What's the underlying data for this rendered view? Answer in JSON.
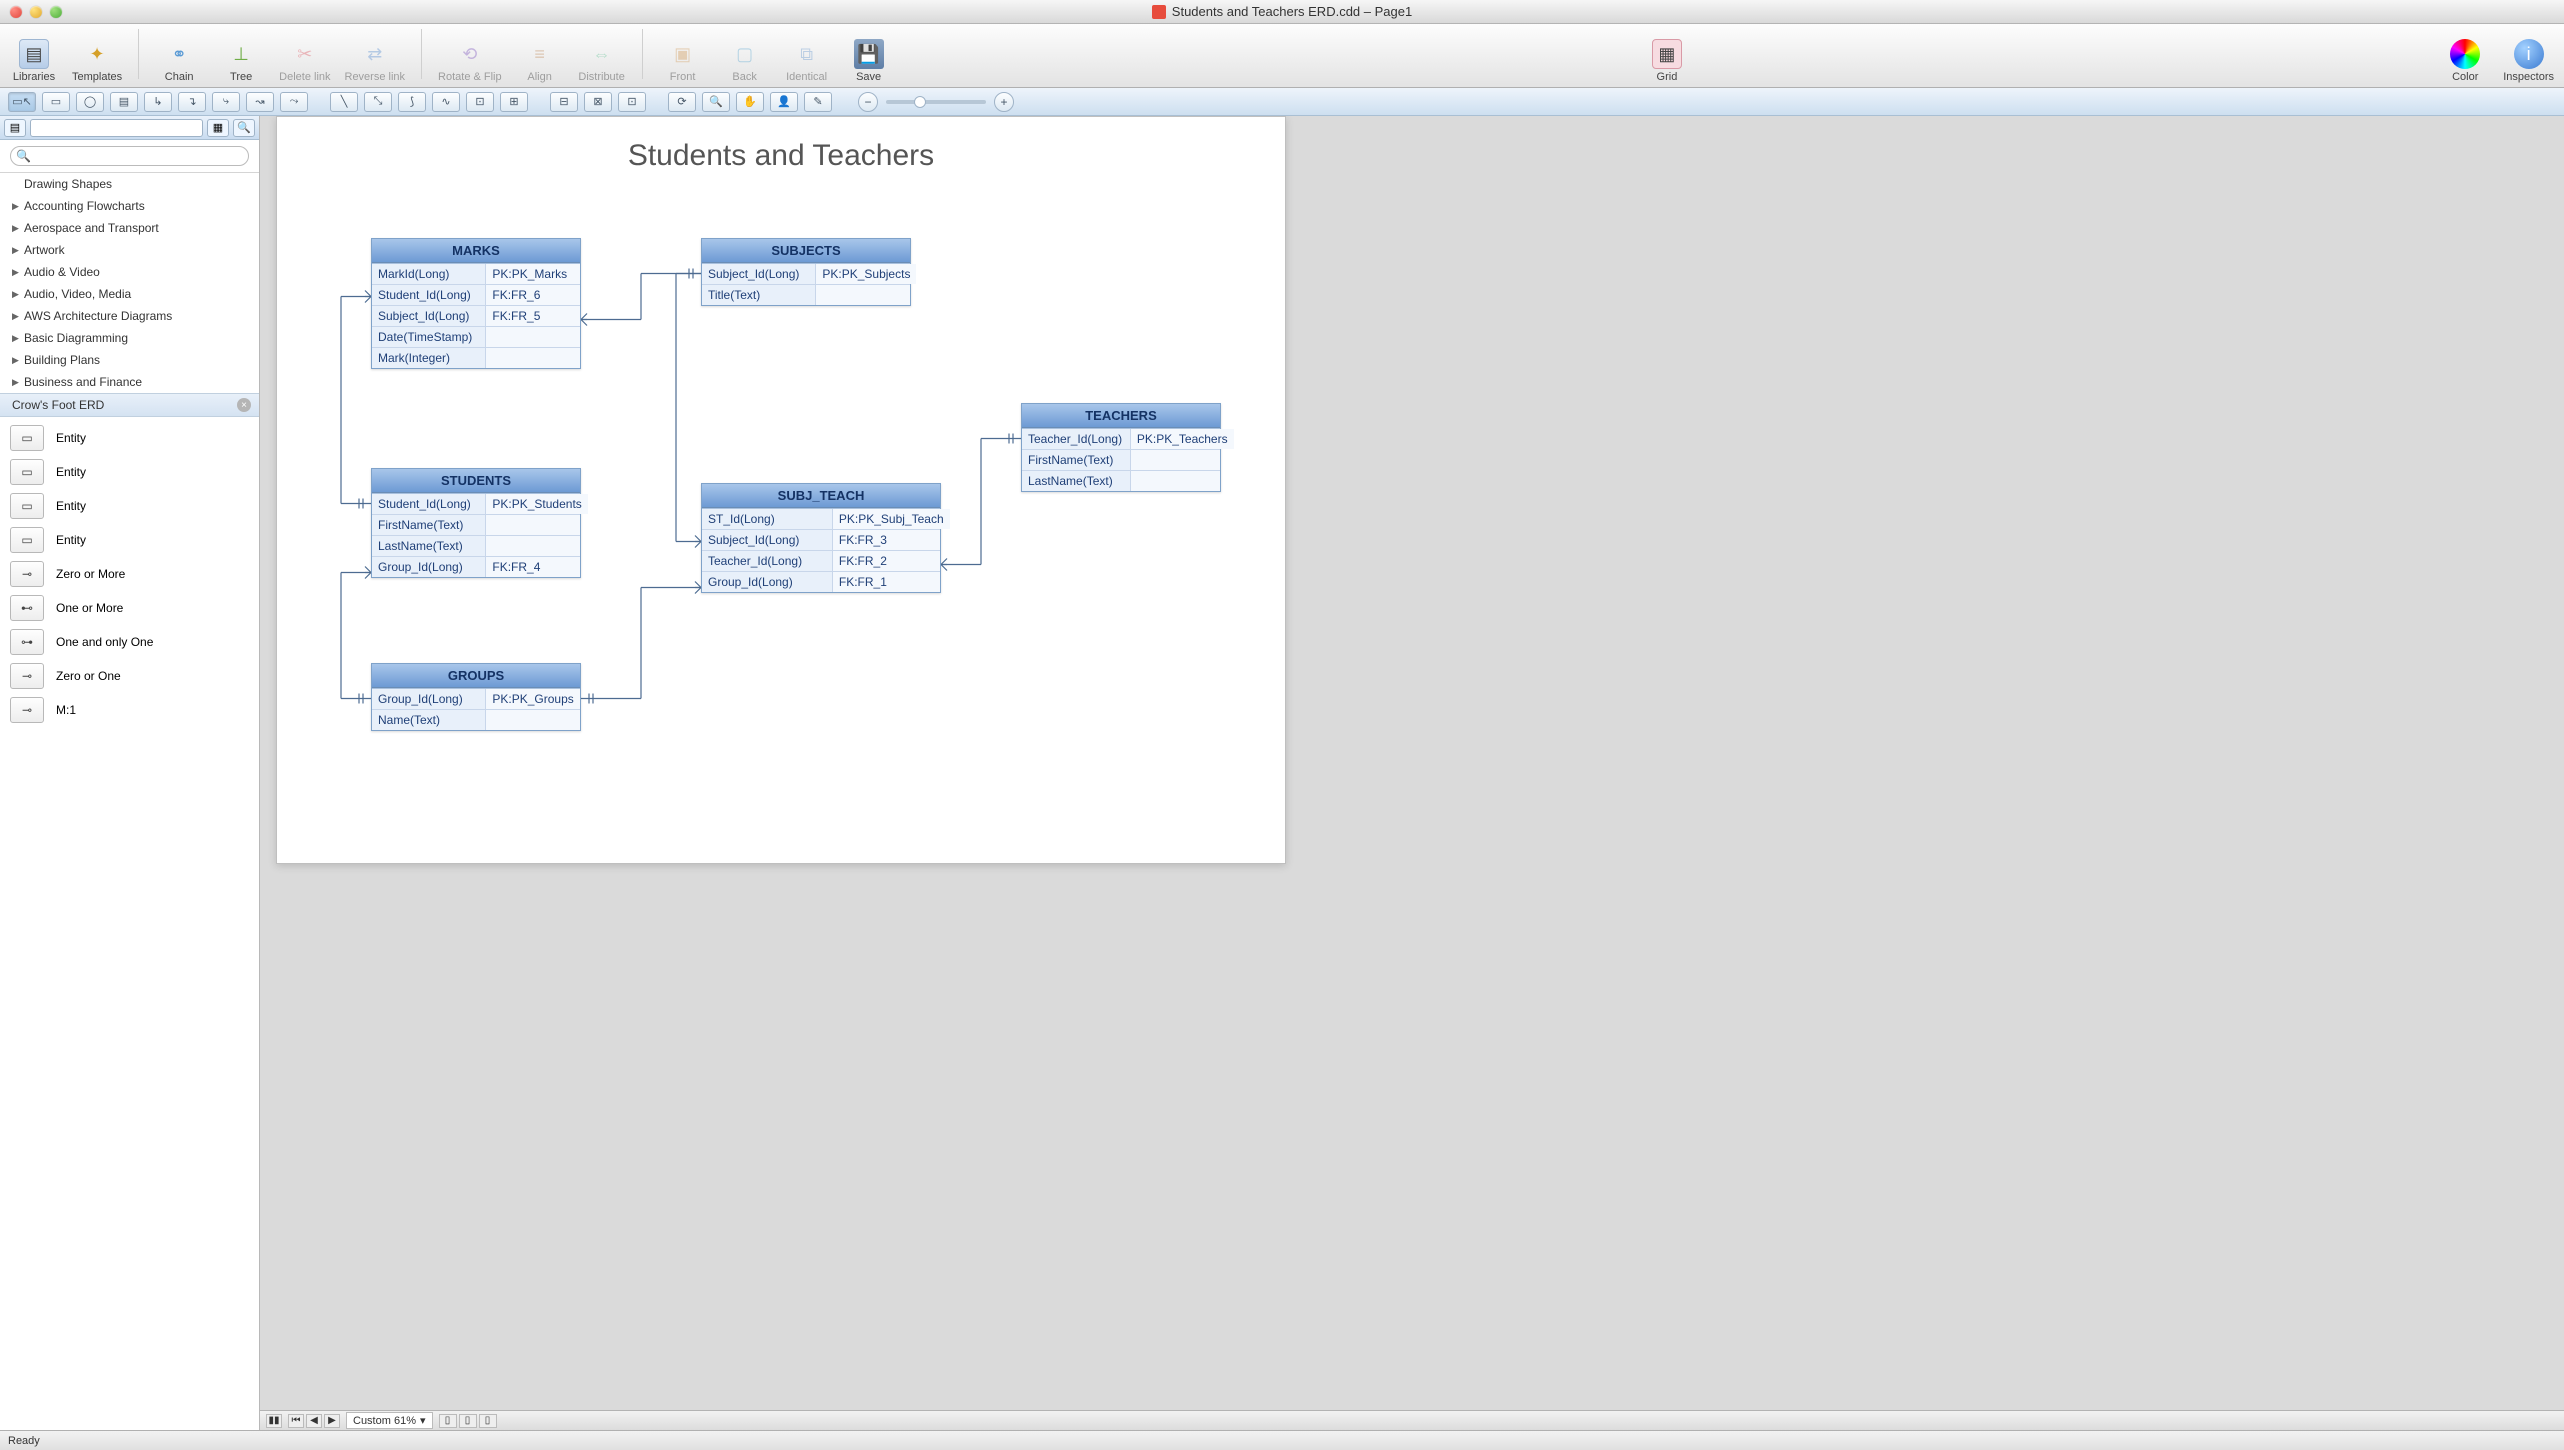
{
  "window": {
    "title": "Students and Teachers ERD.cdd – Page1"
  },
  "toolbar": {
    "libraries": "Libraries",
    "templates": "Templates",
    "chain": "Chain",
    "tree": "Tree",
    "delete_link": "Delete link",
    "reverse_link": "Reverse link",
    "rotate_flip": "Rotate & Flip",
    "align": "Align",
    "distribute": "Distribute",
    "front": "Front",
    "back": "Back",
    "identical": "Identical",
    "save": "Save",
    "grid": "Grid",
    "color": "Color",
    "inspectors": "Inspectors"
  },
  "sidebar": {
    "header_label": "Drawing Shapes",
    "categories": [
      "Accounting Flowcharts",
      "Aerospace and Transport",
      "Artwork",
      "Audio & Video",
      "Audio, Video, Media",
      "AWS Architecture Diagrams",
      "Basic Diagramming",
      "Building Plans",
      "Business and Finance"
    ],
    "active_lib": "Crow's Foot ERD",
    "shapes": [
      "Entity",
      "Entity",
      "Entity",
      "Entity",
      "Zero or More",
      "One or More",
      "One and only One",
      "Zero or One",
      "M:1"
    ]
  },
  "diagram": {
    "title": "Students and Teachers",
    "entities": {
      "marks": {
        "name": "MARKS",
        "rows": [
          {
            "c1": "MarkId(Long)",
            "c2": "PK:PK_Marks"
          },
          {
            "c1": "Student_Id(Long)",
            "c2": "FK:FR_6"
          },
          {
            "c1": "Subject_Id(Long)",
            "c2": "FK:FR_5"
          },
          {
            "c1": "Date(TimeStamp)",
            "c2": ""
          },
          {
            "c1": "Mark(Integer)",
            "c2": ""
          }
        ]
      },
      "subjects": {
        "name": "SUBJECTS",
        "rows": [
          {
            "c1": "Subject_Id(Long)",
            "c2": "PK:PK_Subjects"
          },
          {
            "c1": "Title(Text)",
            "c2": ""
          }
        ]
      },
      "students": {
        "name": "STUDENTS",
        "rows": [
          {
            "c1": "Student_Id(Long)",
            "c2": "PK:PK_Students"
          },
          {
            "c1": "FirstName(Text)",
            "c2": ""
          },
          {
            "c1": "LastName(Text)",
            "c2": ""
          },
          {
            "c1": "Group_Id(Long)",
            "c2": "FK:FR_4"
          }
        ]
      },
      "subj_teach": {
        "name": "SUBJ_TEACH",
        "rows": [
          {
            "c1": "ST_Id(Long)",
            "c2": "PK:PK_Subj_Teach"
          },
          {
            "c1": "Subject_Id(Long)",
            "c2": "FK:FR_3"
          },
          {
            "c1": "Teacher_Id(Long)",
            "c2": "FK:FR_2"
          },
          {
            "c1": "Group_Id(Long)",
            "c2": "FK:FR_1"
          }
        ]
      },
      "teachers": {
        "name": "TEACHERS",
        "rows": [
          {
            "c1": "Teacher_Id(Long)",
            "c2": "PK:PK_Teachers"
          },
          {
            "c1": "FirstName(Text)",
            "c2": ""
          },
          {
            "c1": "LastName(Text)",
            "c2": ""
          }
        ]
      },
      "groups": {
        "name": "GROUPS",
        "rows": [
          {
            "c1": "Group_Id(Long)",
            "c2": "PK:PK_Groups"
          },
          {
            "c1": "Name(Text)",
            "c2": ""
          }
        ]
      }
    },
    "relationships": [
      {
        "from": "STUDENTS.Student_Id",
        "to": "MARKS.Student_Id"
      },
      {
        "from": "SUBJECTS.Subject_Id",
        "to": "MARKS.Subject_Id"
      },
      {
        "from": "SUBJECTS.Subject_Id",
        "to": "SUBJ_TEACH.Subject_Id"
      },
      {
        "from": "TEACHERS.Teacher_Id",
        "to": "SUBJ_TEACH.Teacher_Id"
      },
      {
        "from": "GROUPS.Group_Id",
        "to": "STUDENTS.Group_Id"
      },
      {
        "from": "GROUPS.Group_Id",
        "to": "SUBJ_TEACH.Group_Id"
      }
    ]
  },
  "footer": {
    "zoom_label": "Custom 61%",
    "status": "Ready"
  }
}
